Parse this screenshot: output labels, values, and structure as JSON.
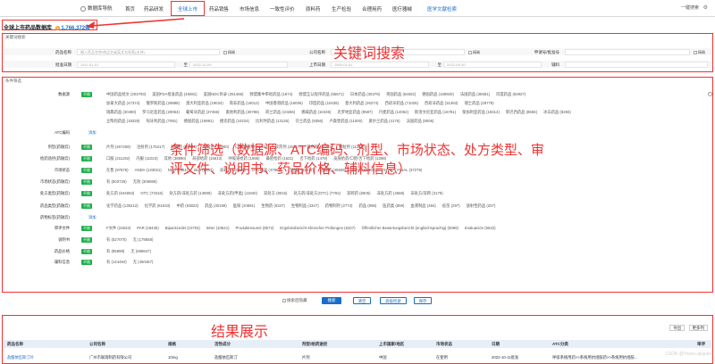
{
  "nav": {
    "logo": "数据库导航",
    "items": [
      "首页",
      "药品研发",
      "全球上市",
      "药品销售",
      "市场信息",
      "一致性评价",
      "原料药",
      "生产检验",
      "合理用药",
      "医疗器械",
      "医学文献检索"
    ],
    "one_click": "一键搜索"
  },
  "database": {
    "title": "全球上市药品数据库",
    "count": "1,766,372条"
  },
  "keyword": {
    "section_label": "关键词搜索",
    "overlay": "关键词搜索",
    "row1": {
      "drug_name": "药品名称",
      "drug_placeholder": "输入药品名称/商品名或英文名检索(支持)",
      "exact": "精确",
      "company": "公司名称",
      "exact2": "精确",
      "approval_no": "申请号/批准号",
      "exact3": "精确"
    },
    "row2": {
      "approval_date": "批准日期",
      "from": "1911-01-01",
      "to_word": "至",
      "to": "2022-10-09",
      "launch_date": "上市日期",
      "from2": "1900-01-01",
      "to_word2": "至",
      "to2": "2022-09-30",
      "excipient": "辅料"
    }
  },
  "conditions": {
    "section_label": "条件筛选",
    "overlay": "条件筛选（数据源、ATC编码、剂型、市场状态、处方类型、审评文件、说明书、药品价格、辅料信息）",
    "unlimited": "不限",
    "add": "添加",
    "rows": [
      {
        "label": "数据源",
        "options": [
          "中国药品批文 (203793)",
          "美国FDA批准药品 (45081)",
          "美国NDC目录 (251466)",
          "欧盟集中审批药品 (1674)",
          "欧盟互认程序药品 (55671)",
          "日本药品 (30379)",
          "英国药品 (64502)",
          "德国药品 (169920)",
          "法国药品 (35581)",
          "印度药品 (64927)"
        ]
      },
      {
        "label": "",
        "options": [
          "加拿大药品 (47374)",
          "俄罗斯药品 (29888)",
          "澳大利亚药品 (19034)",
          "南非药品 (16012)",
          "中国香港药品 (16006)",
          "印度药品 (10439)",
          "意大利药品 (26274)",
          "西班牙药品 (71025)",
          "西班牙药品 (31363)",
          "瑞士药品 (29778)"
        ]
      },
      {
        "label": "",
        "options": [
          "瑞典药品 (30490)",
          "罗马尼亚药品 (29054)",
          "葡萄牙药品 (37456)",
          "奥地利药品 (30786)",
          "荷兰药品 (10266)",
          "挪威药品 (10436)",
          "克罗地亚药品 (9587)",
          "丹麦药品 (14062)",
          "斯洛文尼亚药品 (16781)",
          "保加利亚药品 (18314)",
          "新巴西药品 (8565)",
          "冰岛药品 (8255)"
        ]
      },
      {
        "label": "",
        "options": [
          "立陶宛药品 (18328)",
          "匈牙利药品 (7091)",
          "德国药品 (19991)",
          "捷克药品 (10224)",
          "比利时药品 (13126)",
          "芬兰药品 (9356)",
          "卢森堡药品 (11000)",
          "爱尔兰药品 (4176)",
          "法国药品 (8006)"
        ]
      },
      {
        "label": "ATC编码",
        "add": true
      },
      {
        "label": "剂型(药融云)",
        "options": [
          "片剂 (467269)",
          "注射剂 (175317)",
          "胶囊剂 (99461)",
          "颗粒剂 (18900)",
          "口服溶液剂 (15044)",
          "软膏剂 (15247)",
          "吸剂剂 (11223)",
          "颗粒剂 (11216)"
        ]
      },
      {
        "label": "给药途径(药融云)",
        "options": [
          "口服 (211192)",
          "内服 (11023)",
          "其他 (38890)",
          "局部给药 (16613)",
          "呼吸道给药 (1695)",
          "鼻腔给药 (1621)",
          "舌下给药 (1479)",
          "皮肤给药/口腔/舌下给药 (1398)"
        ]
      },
      {
        "label": "市场状态",
        "options": [
          "在售 (97876)",
          "ANDA (133021)",
          "NDA (7561)",
          "BLA (1047)",
          "非处方 (33361)",
          "OTC药品 (47962)",
          "已过期 (43017)",
          "已注销 (40609)",
          "OTC MONOGRAPH NOT FINAL (37279)"
        ]
      },
      {
        "label": "市场状态(药融云)",
        "options": [
          "有 (603726)",
          "无效 (306869)"
        ]
      },
      {
        "label": "处方类型(药融云)",
        "options": [
          "处方药 (644953)",
          "OTC (73316)",
          "处方药/非处方药 (13980)",
          "非处方药(甲类) (11940)",
          "双处方 (8015)",
          "处方药/非处方(OTC) (7792)",
          "双跨药 (6905)",
          "非处方药 (4558)",
          "非处方/双跨 (3179)"
        ]
      },
      {
        "label": "药品类型(药融云)",
        "options": [
          "化学药品 (135212)",
          "化学药 (61633)",
          "中药 (63823)",
          "药品 (30199)",
          "医保 (10691)",
          "生物药 (6347)",
          "生物制品 (4347)",
          "药物制剂 (2774)",
          "药品 (896)",
          "医药类 (869)",
          "血液制品 (484)",
          "疫苗 (297)",
          "放射性药品 (207)"
        ]
      },
      {
        "label": "药物标签(药融云)",
        "add": true
      },
      {
        "label": "审评文件",
        "options": [
          "F文件 (24523)",
          "PAR (18436)",
          "Bipackzedel (10704)",
          "letter (10541)",
          "Produktresumé (8572)",
          "Ergebnisbericht Klinischer Prüfungen (6327)",
          "Öffentlicher Bewertungsbericht (englischsprachig) (5069)",
          "Evaluación (5542)"
        ]
      },
      {
        "label": "说明书",
        "options": [
          "有 (527070)",
          "无 (179558)"
        ]
      },
      {
        "label": "药品价格",
        "options": [
          "有 (85899)",
          "无 (668647)"
        ]
      },
      {
        "label": "辅料信息",
        "options": [
          "有 (144494)",
          "无 (450467)"
        ]
      }
    ]
  },
  "buttons": {
    "collapse": "搜索后隐藏",
    "search": "搜索",
    "clear": "清空",
    "advanced": "高级检索",
    "save": "保存"
  },
  "results": {
    "overlay": "结果展示",
    "tools": [
      "导出",
      "更多列"
    ],
    "columns": [
      "药品名称",
      "公司名称",
      "规格",
      "活性成分",
      "剂型/给药途径",
      "上市国家/地区",
      "市场状态",
      "日期",
      "ATC分类",
      "审评"
    ],
    "row": [
      "盐酸依匹斯汀片",
      "广州市联瑞制药有限公司",
      "10mg",
      "盐酸依匹斯汀",
      "片剂",
      "中国",
      "在使用",
      "2022-10-11批准",
      "呼吸系统用药>>系统用抗组胺药>>系统用抗组胺..."
    ]
  },
  "watermark": "CSDN @Yaosu.qiujuku"
}
